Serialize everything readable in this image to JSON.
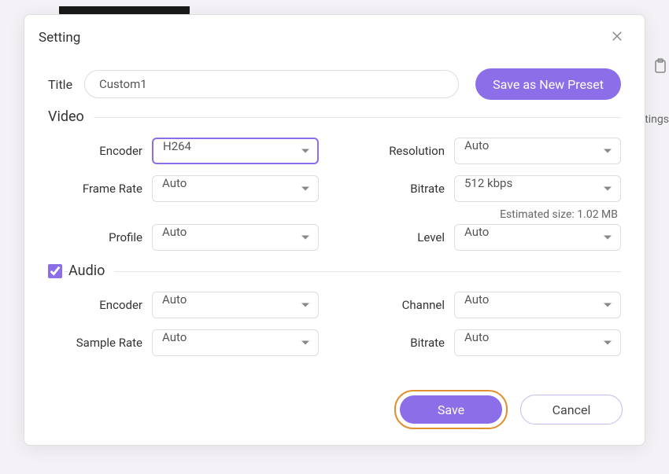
{
  "dialog": {
    "title": "Setting",
    "titleField": {
      "label": "Title",
      "value": "Custom1"
    },
    "newPresetBtn": "Save as New Preset",
    "video": {
      "sectionLabel": "Video",
      "encoder": {
        "label": "Encoder",
        "value": "H264"
      },
      "resolution": {
        "label": "Resolution",
        "value": "Auto"
      },
      "frameRate": {
        "label": "Frame Rate",
        "value": "Auto"
      },
      "bitrate": {
        "label": "Bitrate",
        "value": "512 kbps"
      },
      "estimate": "Estimated size: 1.02 MB",
      "profile": {
        "label": "Profile",
        "value": "Auto"
      },
      "level": {
        "label": "Level",
        "value": "Auto"
      }
    },
    "audio": {
      "sectionLabel": "Audio",
      "checked": true,
      "encoder": {
        "label": "Encoder",
        "value": "Auto"
      },
      "channel": {
        "label": "Channel",
        "value": "Auto"
      },
      "sampleRate": {
        "label": "Sample Rate",
        "value": "Auto"
      },
      "bitrate": {
        "label": "Bitrate",
        "value": "Auto"
      }
    },
    "footer": {
      "save": "Save",
      "cancel": "Cancel"
    }
  },
  "background": {
    "rightText": "ttings"
  }
}
